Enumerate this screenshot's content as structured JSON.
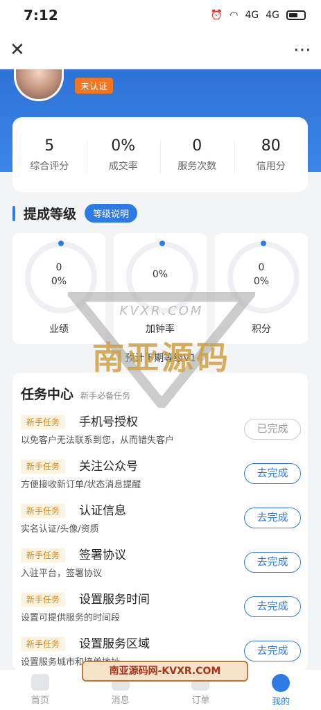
{
  "status": {
    "time": "7:12",
    "signal1": "4G",
    "signal2": "4G"
  },
  "nav": {
    "close_icon": "close-icon",
    "more_icon": "more-icon"
  },
  "profile": {
    "badge": "未认证"
  },
  "stats": [
    {
      "value": "5",
      "label": "综合评分"
    },
    {
      "value": "0%",
      "label": "成交率"
    },
    {
      "value": "0",
      "label": "服务次数"
    },
    {
      "value": "80",
      "label": "信用分"
    }
  ],
  "level": {
    "title": "提成等级",
    "explain_button": "等级说明",
    "cards": [
      {
        "line1": "0",
        "line2": "0%",
        "label": "业绩"
      },
      {
        "line1": "",
        "line2": "0%",
        "label": "加钟率"
      },
      {
        "line1": "0",
        "line2": "0%",
        "label": "积分"
      }
    ],
    "forecast": "预计下期等级V1"
  },
  "tasks": {
    "title": "任务中心",
    "subtitle": "新手必备任务",
    "items": [
      {
        "tag": "新手任务",
        "name": "手机号授权",
        "desc": "以免客户无法联系到您，从而错失客户",
        "button": "已完成",
        "done": true
      },
      {
        "tag": "新手任务",
        "name": "关注公众号",
        "desc": "方便接收新订单/状态消息提醒",
        "button": "去完成",
        "done": false
      },
      {
        "tag": "新手任务",
        "name": "认证信息",
        "desc": "实名认证/头像/资质",
        "button": "去完成",
        "done": false
      },
      {
        "tag": "新手任务",
        "name": "签署协议",
        "desc": "入驻平台，签署协议",
        "button": "去完成",
        "done": false
      },
      {
        "tag": "新手任务",
        "name": "设置服务时间",
        "desc": "设置可提供服务的时间段",
        "button": "去完成",
        "done": false
      },
      {
        "tag": "新手任务",
        "name": "设置服务区域",
        "desc": "设置服务城市和接单地址",
        "button": "去完成",
        "done": false
      }
    ]
  },
  "tabbar": [
    {
      "label": "首页",
      "active": false
    },
    {
      "label": "消息",
      "active": false
    },
    {
      "label": "订单",
      "active": false
    },
    {
      "label": "我的",
      "active": true
    }
  ],
  "watermark": {
    "small": "KVXR.COM",
    "big": "南亚源码",
    "banner": "南亚源码网-KVXR.COM"
  },
  "colors": {
    "primary": "#2f7be5",
    "badge_orange": "#f1761f",
    "tag_bg": "#fdf2dd",
    "tag_text": "#d48a17"
  }
}
